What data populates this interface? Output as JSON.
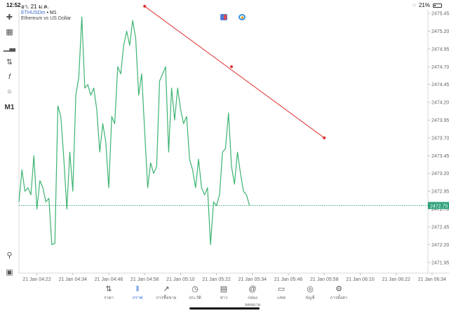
{
  "status_bar": {
    "time": "12:52",
    "date": "อา. 21 ม.ค.",
    "battery": "21%"
  },
  "chart_header": {
    "symbol": "ETHUSDm",
    "separator": "•",
    "timeframe": "M1",
    "description": "Ethereum vs US Dollar"
  },
  "toolbar": {
    "timeframe_label": "M1"
  },
  "nav": [
    {
      "label": "ราคา",
      "icon": "quotes-arrows-icon"
    },
    {
      "label": "กราฟ",
      "icon": "chart-candles-icon",
      "active": true
    },
    {
      "label": "การซื้อขาย",
      "icon": "trade-line-icon"
    },
    {
      "label": "ประวัติ",
      "icon": "history-clock-icon"
    },
    {
      "label": "ข่าว",
      "icon": "news-icon"
    },
    {
      "label": "กล่องจดหมาย",
      "icon": "mailbox-at-icon"
    },
    {
      "label": "แชท",
      "icon": "chat-bubble-icon"
    },
    {
      "label": "บัญชี",
      "icon": "account-user-icon"
    },
    {
      "label": "การตั้งค่า",
      "icon": "settings-gear-icon"
    }
  ],
  "chart_data": {
    "type": "line",
    "symbol": "ETHUSDm",
    "timeframe": "M1",
    "line_color": "#3cb371",
    "current_price": 2472.75,
    "current_price_label": "2472.75",
    "current_price_color": "#2ea07a",
    "y_range": [
      2471.8,
      2475.5
    ],
    "y_ticks": [
      "2475.45",
      "2475.20",
      "2474.95",
      "2474.70",
      "2474.45",
      "2474.20",
      "2473.95",
      "2473.70",
      "2473.45",
      "2473.20",
      "2472.95",
      "2472.70",
      "2472.45",
      "2472.20",
      "2471.95"
    ],
    "x_ticks": [
      "21 Jan 04:22",
      "21 Jan 04:34",
      "21 Jan 04:46",
      "21 Jan 04:58",
      "21 Jan 05:10",
      "21 Jan 05:22",
      "21 Jan 05:34",
      "21 Jan 05:46",
      "21 Jan 05:58",
      "21 Jan 06:10",
      "21 Jan 06:22",
      "21 Jan 06:34"
    ],
    "x_start": "21 Jan 04:16",
    "x_step_minutes": 1,
    "y": [
      2472.8,
      2473.25,
      2472.95,
      2473.0,
      2472.9,
      2473.45,
      2472.7,
      2473.1,
      2473.0,
      2472.8,
      2472.85,
      2472.2,
      2472.22,
      2474.15,
      2474.0,
      2473.4,
      2472.7,
      2473.5,
      2472.95,
      2474.3,
      2474.55,
      2475.4,
      2474.4,
      2474.45,
      2474.3,
      2474.4,
      2474.1,
      2473.5,
      2473.9,
      2473.65,
      2473.0,
      2474.0,
      2473.9,
      2474.7,
      2474.6,
      2475.0,
      2475.2,
      2475.0,
      2475.35,
      2475.1,
      2474.3,
      2474.6,
      2473.8,
      2473.0,
      2473.35,
      2473.2,
      2473.3,
      2474.5,
      2474.6,
      2474.7,
      2473.5,
      2474.4,
      2473.95,
      2474.4,
      2474.1,
      2473.9,
      2474.0,
      2473.4,
      2473.25,
      2473.0,
      2473.4,
      2473.0,
      2472.9,
      2473.0,
      2472.2,
      2472.8,
      2472.75,
      2472.9,
      2473.5,
      2473.55,
      2474.05,
      2473.3,
      2473.05,
      2473.5,
      2473.2,
      2472.95,
      2472.9,
      2472.75
    ],
    "trendline": {
      "color": "#e03030",
      "start": [
        "21 Jan 04:58",
        2475.55
      ],
      "mid": [
        "21 Jan 05:27",
        2474.7
      ],
      "end": [
        "21 Jan 05:58",
        2473.7
      ]
    }
  }
}
